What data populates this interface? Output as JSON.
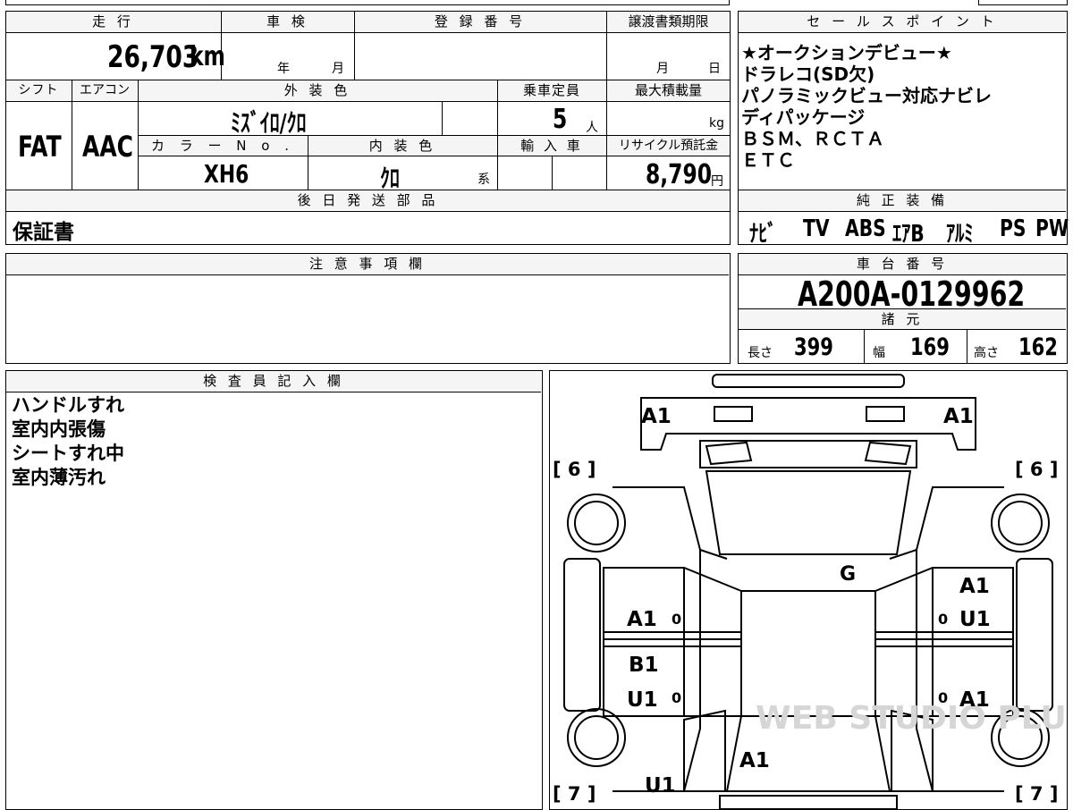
{
  "top_table": {
    "headers": {
      "mileage": "走 行",
      "inspection": "車 検",
      "registration": "登 録 番 号",
      "transfer_deadline": "譲渡書類期限",
      "shift": "シフト",
      "aircon": "エアコン",
      "exterior_color": "外 装 色",
      "capacity": "乗車定員",
      "max_load": "最大積載量",
      "color_no": "カ ラ ー N o .",
      "interior_color": "内 装 色",
      "import": "輸 入 車",
      "recycle_fee": "リサイクル預託金",
      "later_parts": "後 日 発 送 部 品"
    },
    "mileage_value": "26,703",
    "mileage_unit": "km",
    "inspection_year_label": "年",
    "inspection_month_label": "月",
    "transfer_month_label": "月",
    "transfer_day_label": "日",
    "shift_value": "FAT",
    "aircon_value": "AAC",
    "exterior_color_value": "ﾐｽﾞｲﾛ/ｸﾛ",
    "capacity_value": "5",
    "capacity_unit": "人",
    "max_load_unit": "kg",
    "color_no_value": "XH6",
    "interior_color_value": "ｸﾛ",
    "interior_color_suffix": "系",
    "recycle_fee_value": "8,790",
    "recycle_fee_unit": "円",
    "later_parts_value": "保証書"
  },
  "sales_points": {
    "header": "セ ー ル ス ポ イ ン ト",
    "lines": [
      "★オークションデビュー★",
      "ドラレコ(SD欠)",
      "パノラミックビュー対応ナビレ",
      "ディパッケージ",
      "ＢＳＭ、ＲＣＴＡ",
      "ＥＴＣ"
    ]
  },
  "genuine_equipment": {
    "header": "純 正 装 備",
    "items": [
      "ﾅﾋﾞ",
      "TV",
      "ABS",
      "ｴｱB",
      "ｱﾙﾐ",
      "PS",
      "PW"
    ]
  },
  "caution": {
    "header": "注 意 事 項 欄"
  },
  "chassis": {
    "header": "車 台 番 号",
    "value": "A200A-0129962",
    "spec_header": "諸 元",
    "length_label": "長さ",
    "length_value": "399",
    "width_label": "幅",
    "width_value": "169",
    "height_label": "高さ",
    "height_value": "162"
  },
  "inspector": {
    "header": "検 査 員 記 入 欄",
    "notes": [
      "ハンドルすれ",
      "室内内張傷",
      "シートすれ中",
      "室内薄汚れ"
    ]
  },
  "diagram": {
    "marks": {
      "front_left": "A1",
      "front_right": "A1",
      "wheel_fl": "[ 6 ]",
      "wheel_fr": "[ 6 ]",
      "wheel_rl": "[ 7 ]",
      "wheel_rr": "[ 7 ]",
      "windshield": "G",
      "front_door_left": "A1",
      "front_door_right_top": "A1",
      "front_door_right": "U1",
      "rear_door_left_top": "B1",
      "rear_door_left": "U1",
      "rear_door_right": "A1",
      "roof_rear": "A1",
      "rear_left": "U1",
      "zero": "0"
    },
    "watermark": "WEB STUDIO PLUS"
  }
}
